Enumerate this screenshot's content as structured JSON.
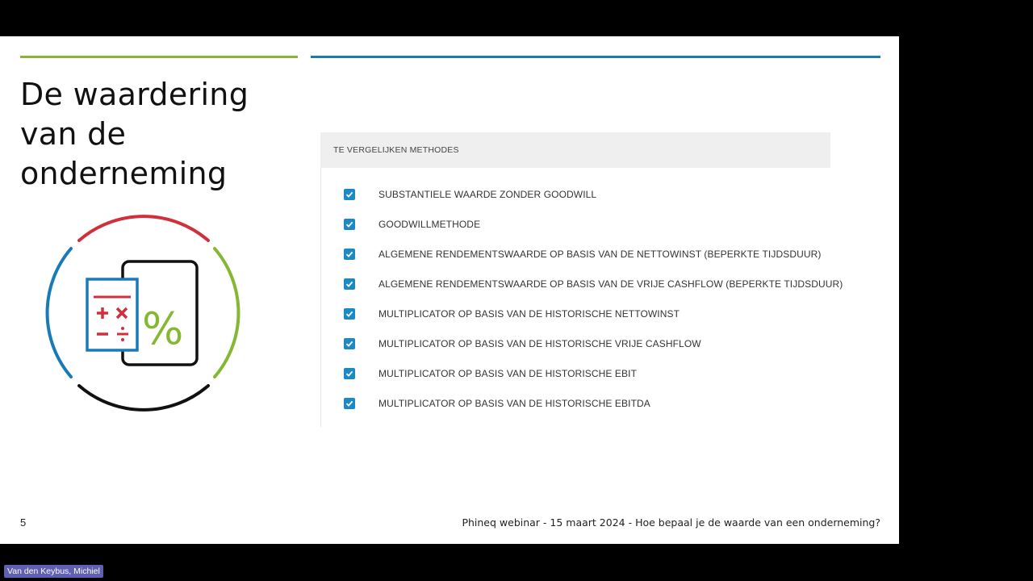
{
  "slide": {
    "title_lines": [
      "De waardering",
      "van de",
      "onderneming"
    ],
    "page_number": "5",
    "footer": "Phineq webinar - 15 maart 2024 - Hoe bepaal je de waarde van een onderneming?"
  },
  "illustration": {
    "icon_name": "calculator-percentage-icon",
    "percent_glyph": "%",
    "colors": {
      "red": "#d0303c",
      "green": "#85b832",
      "blue": "#1a7ab8",
      "black": "#111111"
    }
  },
  "methods_panel": {
    "header": "TE VERGELIJKEN METHODES",
    "items": [
      {
        "label": "SUBSTANTIELE WAARDE ZONDER GOODWILL",
        "checked": true
      },
      {
        "label": "GOODWILLMETHODE",
        "checked": true
      },
      {
        "label": "ALGEMENE RENDEMENTSWAARDE OP BASIS VAN DE NETTOWINST (BEPERKTE TIJDSDUUR)",
        "checked": true
      },
      {
        "label": "ALGEMENE RENDEMENTSWAARDE OP BASIS VAN DE VRIJE CASHFLOW (BEPERKTE TIJDSDUUR)",
        "checked": true
      },
      {
        "label": "MULTIPLICATOR OP BASIS VAN DE HISTORISCHE NETTOWINST",
        "checked": true
      },
      {
        "label": "MULTIPLICATOR OP BASIS VAN DE HISTORISCHE VRIJE CASHFLOW",
        "checked": true
      },
      {
        "label": "MULTIPLICATOR OP BASIS VAN DE HISTORISCHE EBIT",
        "checked": true
      },
      {
        "label": "MULTIPLICATOR OP BASIS VAN DE HISTORISCHE EBITDA",
        "checked": true
      }
    ],
    "checkbox_color": "#1b88c7"
  },
  "participant": {
    "name": "Van den Keybus, Michiel"
  }
}
